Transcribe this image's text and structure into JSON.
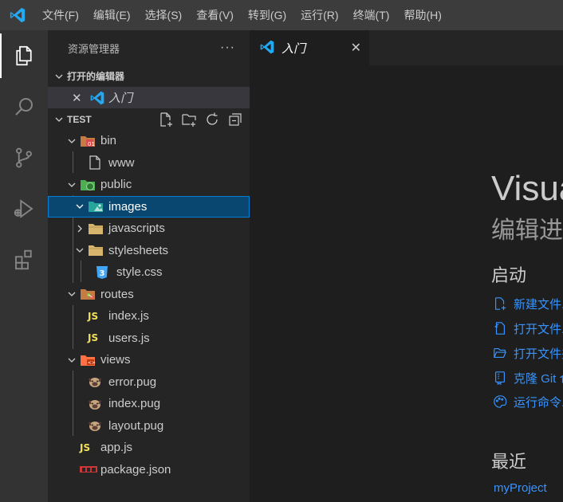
{
  "menu": [
    "文件(F)",
    "编辑(E)",
    "选择(S)",
    "查看(V)",
    "转到(G)",
    "运行(R)",
    "终端(T)",
    "帮助(H)"
  ],
  "sidebar": {
    "title": "资源管理器",
    "more": "···",
    "open_editors_label": "打开的编辑器",
    "open_editor_file": "入门",
    "close_glyph": "✕",
    "folder_label": "TEST"
  },
  "tree": [
    {
      "label": "bin",
      "type": "folder",
      "icon": "bin-folder-icon"
    },
    {
      "label": "www",
      "type": "file",
      "icon": "file-icon"
    },
    {
      "label": "public",
      "type": "folder",
      "icon": "public-folder-icon"
    },
    {
      "label": "images",
      "type": "folder",
      "icon": "images-folder-icon",
      "selected": true
    },
    {
      "label": "javascripts",
      "type": "folder",
      "icon": "folder-icon"
    },
    {
      "label": "stylesheets",
      "type": "folder",
      "icon": "folder-icon"
    },
    {
      "label": "style.css",
      "type": "file",
      "icon": "css-icon"
    },
    {
      "label": "routes",
      "type": "folder",
      "icon": "routes-folder-icon"
    },
    {
      "label": "index.js",
      "type": "file",
      "icon": "js-icon"
    },
    {
      "label": "users.js",
      "type": "file",
      "icon": "js-icon"
    },
    {
      "label": "views",
      "type": "folder",
      "icon": "views-folder-icon"
    },
    {
      "label": "error.pug",
      "type": "file",
      "icon": "pug-icon"
    },
    {
      "label": "index.pug",
      "type": "file",
      "icon": "pug-icon"
    },
    {
      "label": "layout.pug",
      "type": "file",
      "icon": "pug-icon"
    },
    {
      "label": "app.js",
      "type": "file",
      "icon": "js-icon"
    },
    {
      "label": "package.json",
      "type": "file",
      "icon": "npm-icon"
    }
  ],
  "editor": {
    "tab_label": "入门",
    "tab_close": "✕",
    "welcome_title": "Visual Studio Code",
    "welcome_subtitle": "编辑进化",
    "start_heading": "启动",
    "start_links": [
      "新建文件...",
      "打开文件...",
      "打开文件夹...",
      "克隆 Git 仓库...",
      "运行命令..."
    ],
    "recent_heading": "最近",
    "recent_items": [
      "myProject"
    ]
  },
  "colors": {
    "accent": "#007acc",
    "link": "#3794ff",
    "selection": "#094771",
    "js": "#f1e05a",
    "css": "#42a5f5"
  }
}
